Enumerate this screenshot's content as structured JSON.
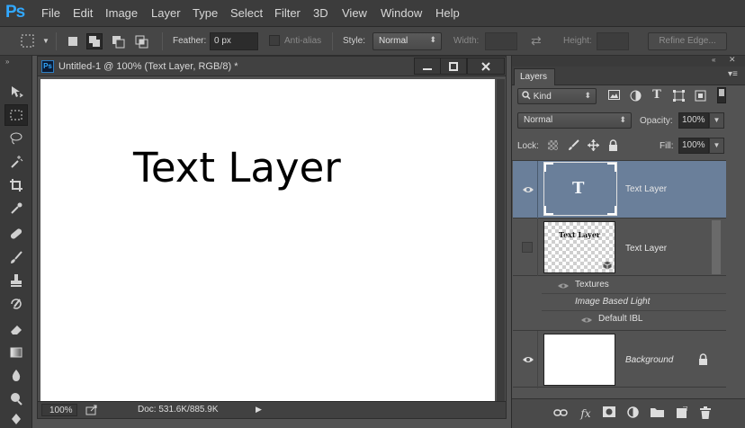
{
  "app": {
    "logo": "Ps"
  },
  "menu": [
    "File",
    "Edit",
    "Image",
    "Layer",
    "Type",
    "Select",
    "Filter",
    "3D",
    "View",
    "Window",
    "Help"
  ],
  "options": {
    "feather_label": "Feather:",
    "feather_value": "0 px",
    "antialias_label": "Anti-alias",
    "style_label": "Style:",
    "style_value": "Normal",
    "width_label": "Width:",
    "height_label": "Height:",
    "refine_edge_label": "Refine Edge..."
  },
  "document": {
    "title": "Untitled-1 @ 100% (Text Layer, RGB/8) *",
    "canvas_text": "Text Layer",
    "zoom": "100%",
    "doc_info": "Doc: 531.6K/885.9K"
  },
  "layers_panel": {
    "tab_label": "Layers",
    "kind_label": "Kind",
    "blend_mode": "Normal",
    "opacity_label": "Opacity:",
    "opacity_value": "100%",
    "lock_label": "Lock:",
    "fill_label": "Fill:",
    "fill_value": "100%",
    "layers": [
      {
        "name": "Text Layer",
        "type": "text",
        "selected": true,
        "visible": true
      },
      {
        "name": "Text Layer",
        "type": "3d",
        "selected": false,
        "visible": false,
        "thumb_text": "Text Layer",
        "sub": {
          "textures_label": "Textures",
          "ibl_label": "Image Based Light",
          "default_ibl_label": "Default IBL"
        }
      },
      {
        "name": "Background",
        "type": "background",
        "selected": false,
        "visible": true,
        "locked": true
      }
    ]
  },
  "colors": {
    "accent": "#31a8ff",
    "selected_layer": "#6a7f9a"
  },
  "icons": [
    "move-tool-icon",
    "marquee-tool-icon",
    "lasso-tool-icon",
    "magic-wand-tool-icon",
    "crop-tool-icon",
    "eyedropper-tool-icon",
    "healing-brush-icon",
    "brush-tool-icon",
    "clone-stamp-icon",
    "history-brush-icon",
    "eraser-tool-icon",
    "gradient-tool-icon",
    "blur-tool-icon",
    "dodge-tool-icon",
    "pen-tool-icon"
  ]
}
